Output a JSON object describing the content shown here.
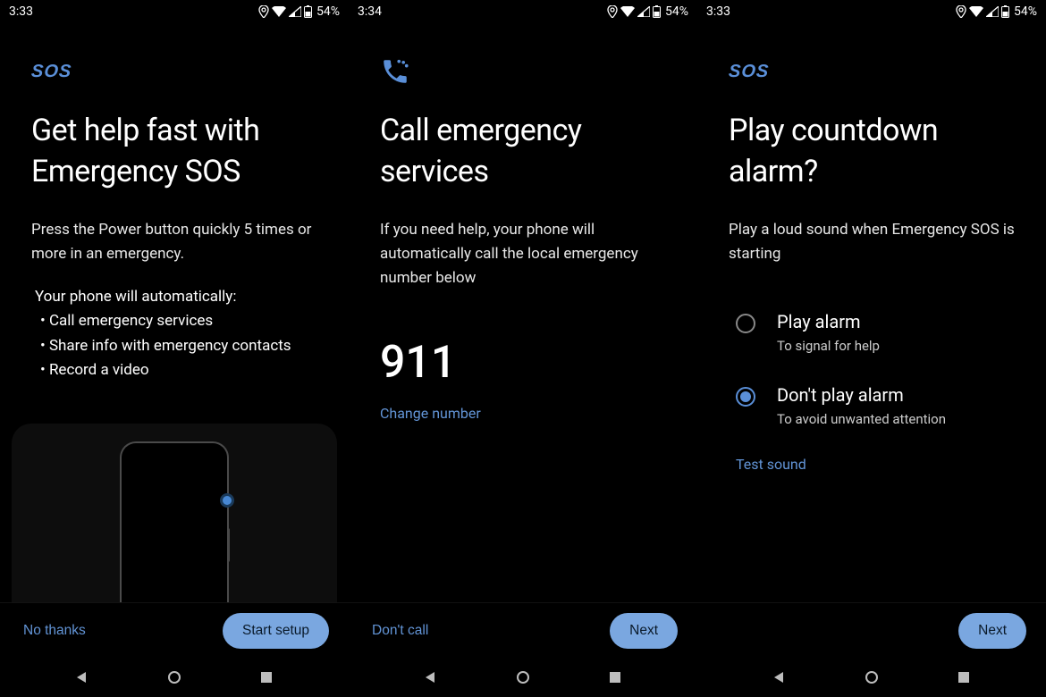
{
  "screens": [
    {
      "status": {
        "time": "3:33",
        "battery": "54%"
      },
      "icon": "sos",
      "title": "Get help fast with Emergency SOS",
      "subtitle": "Press the Power button quickly 5 times or more in an emergency.",
      "list_intro": "Your phone will automatically:",
      "bullets": [
        "Call emergency services",
        "Share info with emergency contacts",
        "Record a video"
      ],
      "footer": {
        "secondary": "No thanks",
        "primary": "Start setup"
      }
    },
    {
      "status": {
        "time": "3:34",
        "battery": "54%"
      },
      "icon": "phone",
      "title": "Call emergency services",
      "subtitle": "If you need help, your phone will automatically call the local emergency number below",
      "number": "911",
      "change_link": "Change number",
      "footer": {
        "secondary": "Don't call",
        "primary": "Next"
      }
    },
    {
      "status": {
        "time": "3:33",
        "battery": "54%"
      },
      "icon": "sos",
      "title": "Play countdown alarm?",
      "subtitle": "Play a loud sound when Emergency SOS is starting",
      "options": [
        {
          "title": "Play alarm",
          "sub": "To signal for help",
          "checked": false
        },
        {
          "title": "Don't play alarm",
          "sub": "To avoid unwanted attention",
          "checked": true
        }
      ],
      "test_link": "Test sound",
      "footer": {
        "secondary": "",
        "primary": "Next"
      }
    }
  ]
}
